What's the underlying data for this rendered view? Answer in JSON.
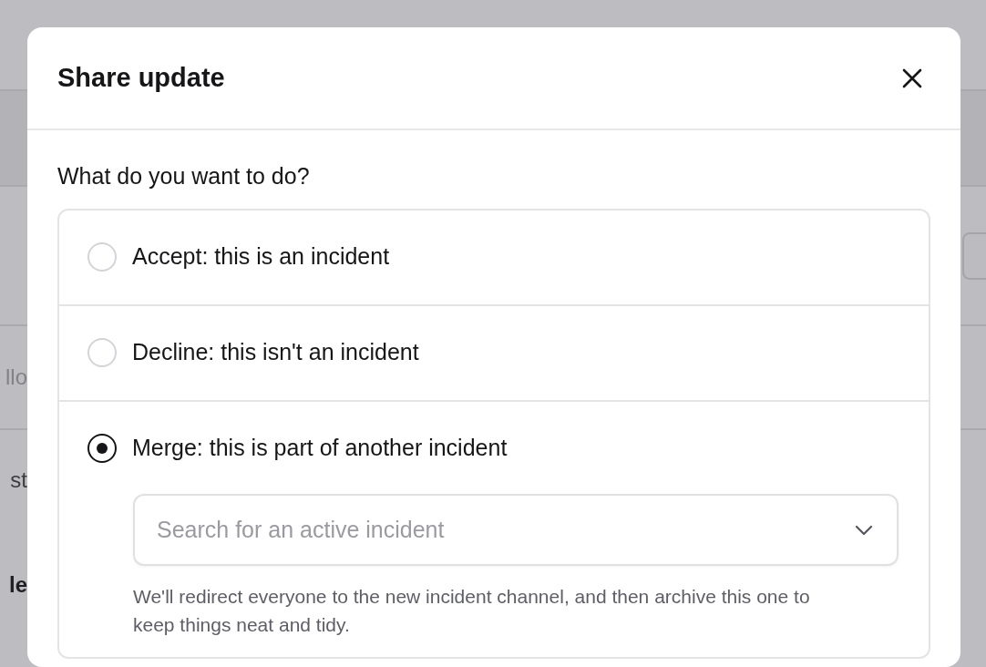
{
  "background": {
    "fragments": [
      {
        "text": "llo",
        "kind": "muted"
      },
      {
        "text": "st",
        "kind": "plain"
      },
      {
        "text": "le",
        "kind": "bold"
      }
    ]
  },
  "dialog": {
    "title": "Share update",
    "question": "What do you want to do?",
    "options": [
      {
        "label": "Accept: this is an incident",
        "selected": false
      },
      {
        "label": "Decline: this isn't an incident",
        "selected": false
      },
      {
        "label": "Merge: this is part of another incident",
        "selected": true,
        "search": {
          "placeholder": "Search for an active incident"
        },
        "help": "We'll redirect everyone to the new incident channel, and then archive this one to keep things neat and tidy."
      }
    ]
  }
}
